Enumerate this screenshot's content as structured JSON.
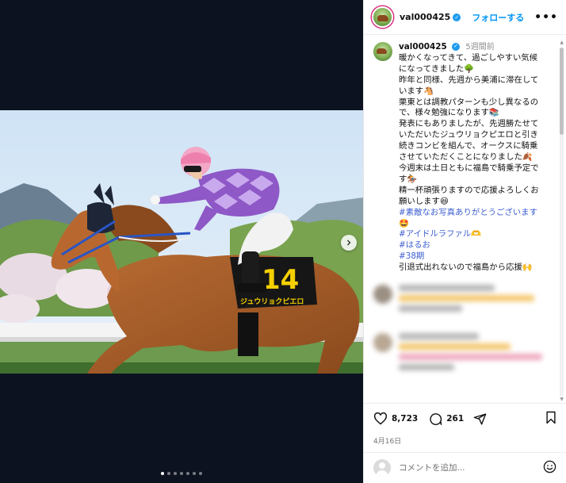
{
  "post": {
    "username": "val000425",
    "follow_label": "フォローする",
    "more_label": "•••",
    "time_ago": "5週間前",
    "caption_lines": [
      "暖かくなってきて、過ごしやすい気候になってきました🌳",
      "昨年と同様、先週から美浦に滞在しています🐴",
      "栗東とは調教パターンも少し異なるので、様々勉強になります📚",
      "発表にもありましたが、先週勝たせていただいたジュウリョクピエロと引き続きコンビを組んで、オークスに騎乗させていただくことになりました🍂",
      "今週末は土日ともに福島で騎乗予定です🏇",
      "精一杯頑張りますので応援よろしくお願いします😆"
    ],
    "hashtags": [
      "#素敵なお写真ありがとうございます🤩",
      "#アイドルラファル🫶",
      "#はるお",
      "#38期"
    ],
    "closing_line": "引退式出れないので福島から応援🙌",
    "likes": "8,723",
    "comments_count": "261",
    "date": "4月16日",
    "comment_placeholder": "コメントを追加..."
  },
  "photo": {
    "saddle_number": "14",
    "horse_name": "ジュウリョクピエロ"
  },
  "carousel": {
    "count": 7,
    "active_index": 0
  },
  "colors": {
    "accent": "#0095f6",
    "hashtag": "#3d5fd1",
    "media_bg": "#0d1220"
  }
}
